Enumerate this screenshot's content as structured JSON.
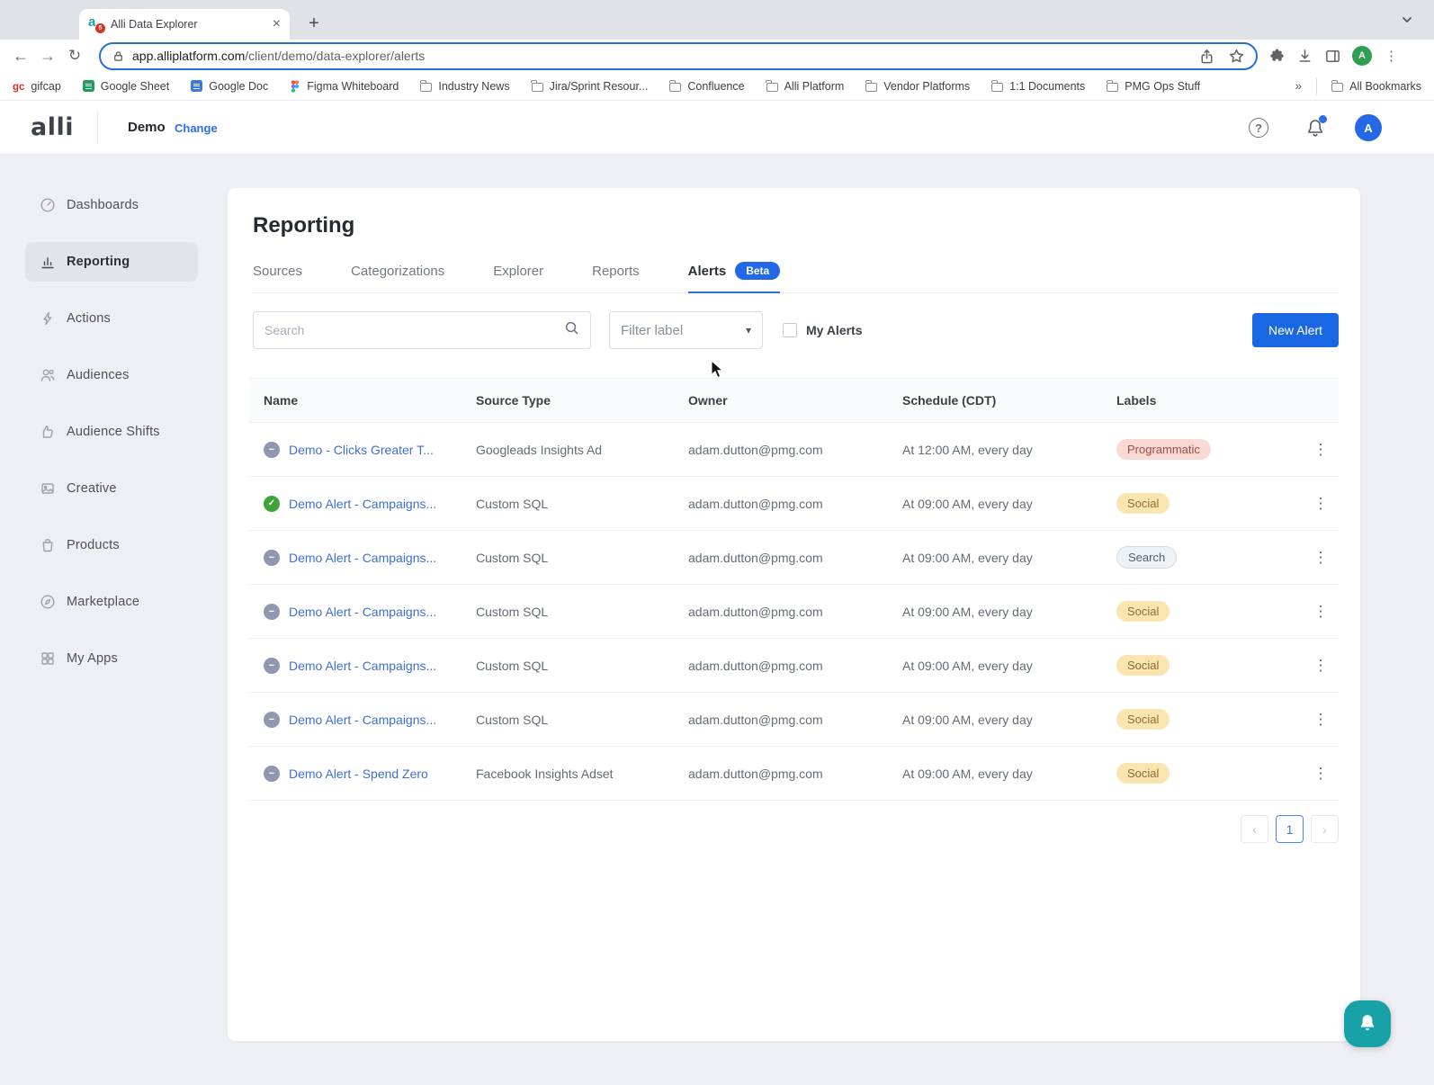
{
  "browser": {
    "tab_title": "Alli Data Explorer",
    "favicon_badge": "5",
    "url_domain": "app.alliplatform.com",
    "url_path": "/client/demo/data-explorer/alerts",
    "profile_initial": "A",
    "bookmarks": [
      {
        "label": "gifcap",
        "icon": "gifcap-icon"
      },
      {
        "label": "Google Sheet",
        "icon": "google-sheets-icon"
      },
      {
        "label": "Google Doc",
        "icon": "google-docs-icon"
      },
      {
        "label": "Figma Whiteboard",
        "icon": "figma-icon"
      },
      {
        "label": "Industry News",
        "icon": "folder-icon"
      },
      {
        "label": "Jira/Sprint Resour...",
        "icon": "folder-icon"
      },
      {
        "label": "Confluence",
        "icon": "folder-icon"
      },
      {
        "label": "Alli Platform",
        "icon": "folder-icon"
      },
      {
        "label": "Vendor Platforms",
        "icon": "folder-icon"
      },
      {
        "label": "1:1 Documents",
        "icon": "folder-icon"
      },
      {
        "label": "PMG Ops Stuff",
        "icon": "folder-icon"
      }
    ],
    "all_bookmarks_label": "All Bookmarks"
  },
  "header": {
    "logo": "alli",
    "client": "Demo",
    "change_link": "Change",
    "avatar_initial": "A"
  },
  "sidebar": {
    "items": [
      {
        "label": "Dashboards",
        "icon": "dashboards-icon",
        "active": false
      },
      {
        "label": "Reporting",
        "icon": "reporting-icon",
        "active": true
      },
      {
        "label": "Actions",
        "icon": "actions-icon",
        "active": false
      },
      {
        "label": "Audiences",
        "icon": "audiences-icon",
        "active": false
      },
      {
        "label": "Audience Shifts",
        "icon": "audience-shifts-icon",
        "active": false
      },
      {
        "label": "Creative",
        "icon": "creative-icon",
        "active": false
      },
      {
        "label": "Products",
        "icon": "products-icon",
        "active": false
      },
      {
        "label": "Marketplace",
        "icon": "marketplace-icon",
        "active": false
      },
      {
        "label": "My Apps",
        "icon": "my-apps-icon",
        "active": false
      }
    ]
  },
  "main": {
    "title": "Reporting",
    "tabs": [
      {
        "label": "Sources",
        "active": false
      },
      {
        "label": "Categorizations",
        "active": false
      },
      {
        "label": "Explorer",
        "active": false
      },
      {
        "label": "Reports",
        "active": false
      },
      {
        "label": "Alerts",
        "badge": "Beta",
        "active": true
      }
    ],
    "controls": {
      "search_placeholder": "Search",
      "filter_label": "Filter label",
      "my_alerts_label": "My Alerts",
      "new_alert_label": "New Alert"
    },
    "table": {
      "columns": [
        "Name",
        "Source Type",
        "Owner",
        "Schedule (CDT)",
        "Labels"
      ],
      "rows": [
        {
          "status": "paused",
          "name": "Demo - Clicks Greater T...",
          "source_type": "Googleads Insights Ad",
          "owner": "adam.dutton@pmg.com",
          "schedule": "At 12:00 AM, every day",
          "label": "Programmatic",
          "label_style": "programmatic"
        },
        {
          "status": "active",
          "name": "Demo Alert - Campaigns...",
          "source_type": "Custom SQL",
          "owner": "adam.dutton@pmg.com",
          "schedule": "At 09:00 AM, every day",
          "label": "Social",
          "label_style": "social"
        },
        {
          "status": "paused",
          "name": "Demo Alert - Campaigns...",
          "source_type": "Custom SQL",
          "owner": "adam.dutton@pmg.com",
          "schedule": "At 09:00 AM, every day",
          "label": "Search",
          "label_style": "search"
        },
        {
          "status": "paused",
          "name": "Demo Alert - Campaigns...",
          "source_type": "Custom SQL",
          "owner": "adam.dutton@pmg.com",
          "schedule": "At 09:00 AM, every day",
          "label": "Social",
          "label_style": "social"
        },
        {
          "status": "paused",
          "name": "Demo Alert - Campaigns...",
          "source_type": "Custom SQL",
          "owner": "adam.dutton@pmg.com",
          "schedule": "At 09:00 AM, every day",
          "label": "Social",
          "label_style": "social"
        },
        {
          "status": "paused",
          "name": "Demo Alert - Campaigns...",
          "source_type": "Custom SQL",
          "owner": "adam.dutton@pmg.com",
          "schedule": "At 09:00 AM, every day",
          "label": "Social",
          "label_style": "social"
        },
        {
          "status": "paused",
          "name": "Demo Alert - Spend Zero",
          "source_type": "Facebook Insights Adset",
          "owner": "adam.dutton@pmg.com",
          "schedule": "At 09:00 AM, every day",
          "label": "Social",
          "label_style": "social"
        }
      ]
    },
    "pagination": {
      "current_page": "1"
    }
  },
  "colors": {
    "accent_blue": "#1a67e4",
    "link_blue": "#3e6fd0",
    "beta_badge": "#2468e8",
    "label_programmatic_bg": "#f8d9d4",
    "label_social_bg": "#fae4b0",
    "label_search_bg": "#eef1f6",
    "status_active_green": "#3fa33c",
    "status_paused_gray": "#8e99af",
    "fab_teal": "#17a2a8",
    "page_background": "#edeff4"
  }
}
